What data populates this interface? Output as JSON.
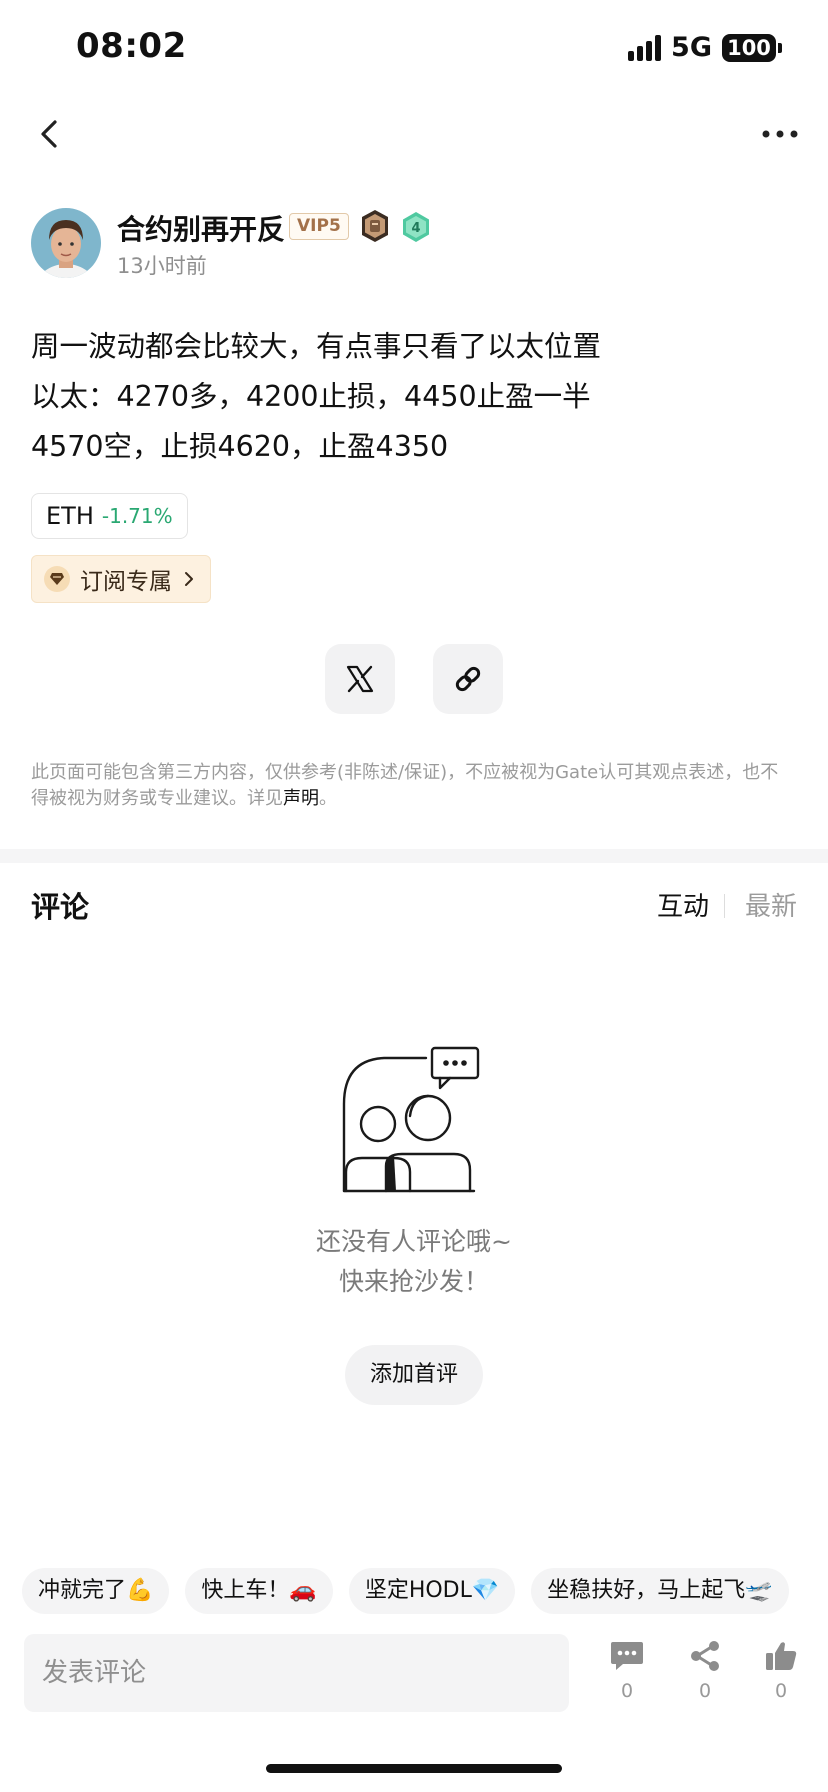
{
  "status_bar": {
    "time": "08:02",
    "network": "5G",
    "battery": "100"
  },
  "author": {
    "name": "合约别再开反",
    "vip": "VIP5",
    "level": "4",
    "time_ago": "13小时前"
  },
  "post": {
    "lines": [
      "周一波动都会比较大，有点事只看了以太位置",
      "以太：4270多，4200止损，4450止盈一半",
      "4570空，止损4620，止盈4350"
    ]
  },
  "ticker": {
    "symbol": "ETH",
    "change": "-1.71%",
    "change_color": "#2aa872"
  },
  "subscribe": {
    "label": "订阅专属"
  },
  "disclaimer": {
    "text": "此页面可能包含第三方内容，仅供参考(非陈述/保证)，不应被视为Gate认可其观点表述，也不得被视为财务或专业建议。详见",
    "link": "声明",
    "suffix": "。"
  },
  "comments": {
    "title": "评论",
    "tabs": {
      "interact": "互动",
      "latest": "最新"
    },
    "empty_line1": "还没有人评论哦~",
    "empty_line2": "快来抢沙发！",
    "add_first": "添加首评"
  },
  "quick_replies": [
    "冲就完了💪",
    "快上车！🚗",
    "坚定HODL💎",
    "坐稳扶好，马上起飞🛫"
  ],
  "input": {
    "placeholder": "发表评论"
  },
  "actions": {
    "comments": "0",
    "shares": "0",
    "likes": "0"
  },
  "colors": {
    "positive_change": "#2aa872",
    "vip_text": "#a3714a",
    "level_badge": "#4fc9a0"
  }
}
